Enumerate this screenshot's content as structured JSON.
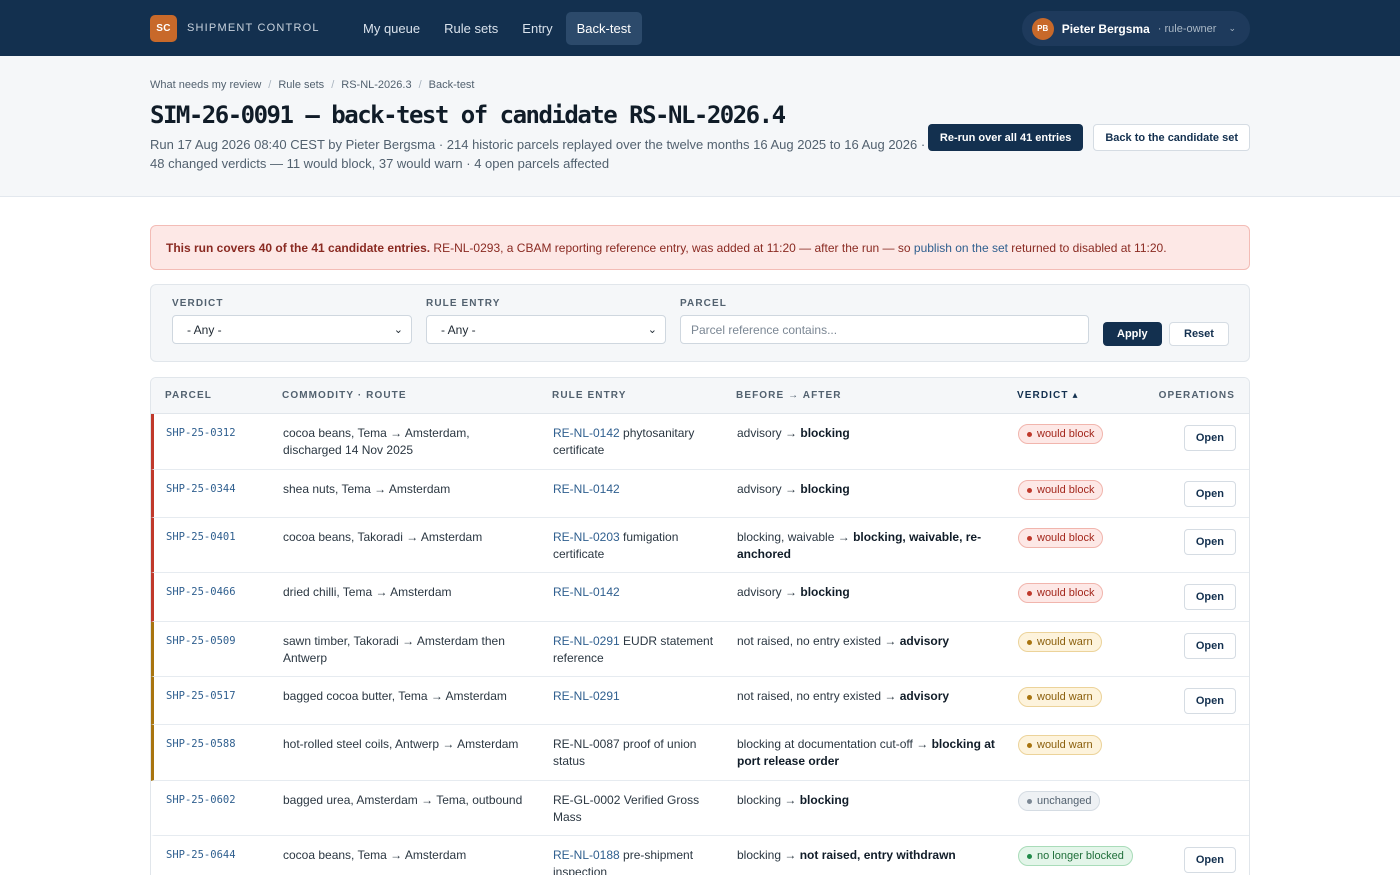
{
  "brand": {
    "logo": "SC",
    "name": "SHIPMENT CONTROL"
  },
  "nav": [
    {
      "label": "My queue",
      "active": false
    },
    {
      "label": "Rule sets",
      "active": false
    },
    {
      "label": "Entry",
      "active": false
    },
    {
      "label": "Back-test",
      "active": true
    }
  ],
  "user": {
    "initials": "PB",
    "name": "Pieter Bergsma",
    "role": "· rule-owner",
    "icon": "chevron-down-icon"
  },
  "breadcrumb": [
    "What needs my review",
    "Rule sets",
    "RS-NL-2026.3",
    "Back-test"
  ],
  "page": {
    "title": "SIM-26-0091 — back-test of candidate RS-NL-2026.4",
    "subtitle": "Run 17 Aug 2026 08:40 CEST by Pieter Bergsma · 214 historic parcels replayed over the twelve months 16 Aug 2025 to 16 Aug 2026 · 48 changed verdicts — 11 would block, 37 would warn · 4 open parcels affected",
    "rerun_label": "Re-run over all 41 entries",
    "back_label": "Back to the candidate set"
  },
  "alert": {
    "strong": "This run covers 40 of the 41 candidate entries.",
    "text1": " RE-NL-0293, a CBAM reporting reference entry, was added at 11:20 — after the run — so ",
    "link1": "publish on the set",
    "text2": " returned to disabled at 11:20."
  },
  "filters": {
    "verdict_label": "VERDICT",
    "verdict_value": "- Any -",
    "rule_label": "RULE ENTRY",
    "rule_value": "- Any -",
    "parcel_label": "PARCEL",
    "parcel_placeholder": "Parcel reference contains...",
    "apply_label": "Apply",
    "reset_label": "Reset"
  },
  "table": {
    "headers": [
      "PARCEL",
      "COMMODITY · ROUTE",
      "RULE ENTRY",
      "BEFORE → AFTER",
      "VERDICT ▴",
      "OPERATIONS"
    ],
    "rows": [
      {
        "parcel": "SHP-25-0312",
        "commodity": "cocoa beans, Tema → Amsterdam, discharged 14 Nov 2025",
        "rule_link": "RE-NL-0142",
        "rule_text": " phytosanitary certificate",
        "before": "advisory → ",
        "after": "blocking",
        "verdict": "would block",
        "kind": "block",
        "open": "Open"
      },
      {
        "parcel": "SHP-25-0344",
        "commodity": "shea nuts, Tema → Amsterdam",
        "rule_link": "RE-NL-0142",
        "rule_text": "",
        "before": "advisory → ",
        "after": "blocking",
        "verdict": "would block",
        "kind": "block",
        "open": "Open"
      },
      {
        "parcel": "SHP-25-0401",
        "commodity": "cocoa beans, Takoradi → Amsterdam",
        "rule_link": "RE-NL-0203",
        "rule_text": " fumigation certificate",
        "before": "blocking, waivable → ",
        "after": "blocking, waivable, re-anchored",
        "verdict": "would block",
        "kind": "block",
        "open": "Open"
      },
      {
        "parcel": "SHP-25-0466",
        "commodity": "dried chilli, Tema → Amsterdam",
        "rule_link": "RE-NL-0142",
        "rule_text": "",
        "before": "advisory → ",
        "after": "blocking",
        "verdict": "would block",
        "kind": "block",
        "open": "Open"
      },
      {
        "parcel": "SHP-25-0509",
        "commodity": "sawn timber, Takoradi → Amsterdam then Antwerp",
        "rule_link": "RE-NL-0291",
        "rule_text": " EUDR statement reference",
        "before": "not raised, no entry existed → ",
        "after": "advisory",
        "verdict": "would warn",
        "kind": "warn",
        "open": "Open"
      },
      {
        "parcel": "SHP-25-0517",
        "commodity": "bagged cocoa butter, Tema → Amsterdam",
        "rule_link": "RE-NL-0291",
        "rule_text": "",
        "before": "not raised, no entry existed → ",
        "after": "advisory",
        "verdict": "would warn",
        "kind": "warn",
        "open": "Open"
      },
      {
        "parcel": "SHP-25-0588",
        "commodity": "hot-rolled steel coils, Antwerp → Amsterdam",
        "rule_link": "",
        "rule_text": "RE-NL-0087 proof of union status",
        "before": "blocking at documentation cut-off → ",
        "after": "blocking at port release order",
        "verdict": "would warn",
        "kind": "warn",
        "open": ""
      },
      {
        "parcel": "SHP-25-0602",
        "commodity": "bagged urea, Amsterdam → Tema, outbound",
        "rule_link": "",
        "rule_text": "RE-GL-0002 Verified Gross Mass",
        "before": "blocking → ",
        "after": "blocking",
        "verdict": "unchanged",
        "kind": "neutral",
        "open": ""
      },
      {
        "parcel": "SHP-25-0644",
        "commodity": "cocoa beans, Tema → Amsterdam",
        "rule_link": "RE-NL-0188",
        "rule_text": " pre-shipment inspection",
        "before": "blocking → ",
        "after": "not raised, entry withdrawn",
        "verdict": "no longer blocked",
        "kind": "good",
        "open": "Open"
      }
    ]
  }
}
